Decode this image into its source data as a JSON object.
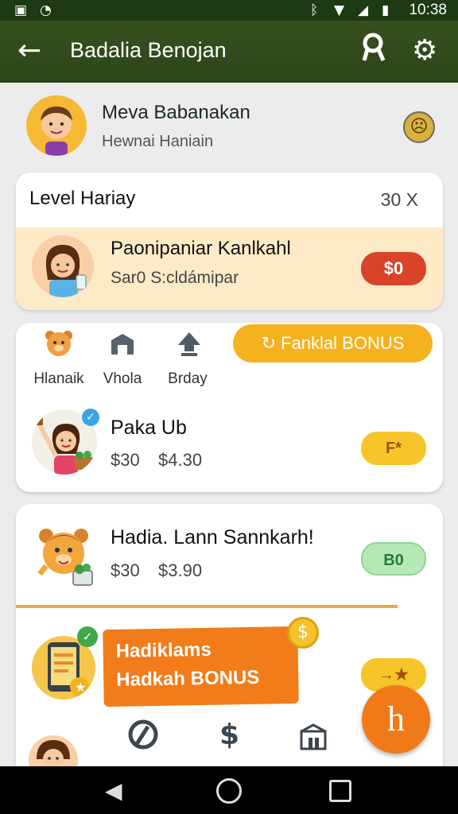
{
  "status_bar": {
    "time": "10:38"
  },
  "app_bar": {
    "title": "Badalia Benojan"
  },
  "profile": {
    "name": "Meva Babanakan",
    "subtitle": "Hewnai Haniain"
  },
  "level_card": {
    "title": "Level Hariay",
    "value": "30 X",
    "promo": {
      "title": "Paonipaniar Kanlkahl",
      "subtitle": "Sar0 S:cldámipar",
      "badge": "$0"
    }
  },
  "bonus_button": {
    "label": "Fanklal BONUS"
  },
  "tabs": [
    {
      "label": "Hlanaik",
      "icon": "bear-icon"
    },
    {
      "label": "Vhola",
      "icon": "home-icon"
    },
    {
      "label": "Brday",
      "icon": "upload-icon"
    }
  ],
  "items": [
    {
      "title": "Paka Ub",
      "price_old": "$30",
      "price_new": "$4.30",
      "badge": "F*"
    },
    {
      "title": "Hadia. Lann Sannkarh!",
      "price_old": "$30",
      "price_new": "$3.90",
      "badge": "B0"
    }
  ],
  "banner": {
    "line1": "Hadiklams",
    "line2": "Hadkah BONUS"
  },
  "bottom_row_icons": [
    "leaf-icon",
    "dollar-icon",
    "store-icon"
  ],
  "colors": {
    "app_bar": "#2c461a",
    "accent_orange": "#f27b1a",
    "accent_yellow": "#f4b21e",
    "badge_red": "#d9432a"
  }
}
